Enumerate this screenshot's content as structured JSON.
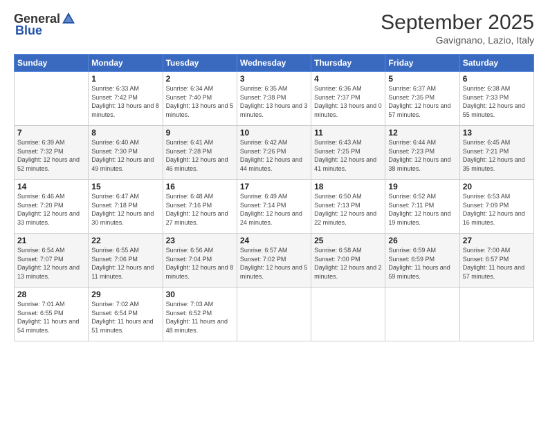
{
  "header": {
    "logo_general": "General",
    "logo_blue": "Blue",
    "month_title": "September 2025",
    "subtitle": "Gavignano, Lazio, Italy"
  },
  "days_of_week": [
    "Sunday",
    "Monday",
    "Tuesday",
    "Wednesday",
    "Thursday",
    "Friday",
    "Saturday"
  ],
  "weeks": [
    [
      {
        "day": "",
        "sunrise": "",
        "sunset": "",
        "daylight": ""
      },
      {
        "day": "1",
        "sunrise": "Sunrise: 6:33 AM",
        "sunset": "Sunset: 7:42 PM",
        "daylight": "Daylight: 13 hours and 8 minutes."
      },
      {
        "day": "2",
        "sunrise": "Sunrise: 6:34 AM",
        "sunset": "Sunset: 7:40 PM",
        "daylight": "Daylight: 13 hours and 5 minutes."
      },
      {
        "day": "3",
        "sunrise": "Sunrise: 6:35 AM",
        "sunset": "Sunset: 7:38 PM",
        "daylight": "Daylight: 13 hours and 3 minutes."
      },
      {
        "day": "4",
        "sunrise": "Sunrise: 6:36 AM",
        "sunset": "Sunset: 7:37 PM",
        "daylight": "Daylight: 13 hours and 0 minutes."
      },
      {
        "day": "5",
        "sunrise": "Sunrise: 6:37 AM",
        "sunset": "Sunset: 7:35 PM",
        "daylight": "Daylight: 12 hours and 57 minutes."
      },
      {
        "day": "6",
        "sunrise": "Sunrise: 6:38 AM",
        "sunset": "Sunset: 7:33 PM",
        "daylight": "Daylight: 12 hours and 55 minutes."
      }
    ],
    [
      {
        "day": "7",
        "sunrise": "Sunrise: 6:39 AM",
        "sunset": "Sunset: 7:32 PM",
        "daylight": "Daylight: 12 hours and 52 minutes."
      },
      {
        "day": "8",
        "sunrise": "Sunrise: 6:40 AM",
        "sunset": "Sunset: 7:30 PM",
        "daylight": "Daylight: 12 hours and 49 minutes."
      },
      {
        "day": "9",
        "sunrise": "Sunrise: 6:41 AM",
        "sunset": "Sunset: 7:28 PM",
        "daylight": "Daylight: 12 hours and 46 minutes."
      },
      {
        "day": "10",
        "sunrise": "Sunrise: 6:42 AM",
        "sunset": "Sunset: 7:26 PM",
        "daylight": "Daylight: 12 hours and 44 minutes."
      },
      {
        "day": "11",
        "sunrise": "Sunrise: 6:43 AM",
        "sunset": "Sunset: 7:25 PM",
        "daylight": "Daylight: 12 hours and 41 minutes."
      },
      {
        "day": "12",
        "sunrise": "Sunrise: 6:44 AM",
        "sunset": "Sunset: 7:23 PM",
        "daylight": "Daylight: 12 hours and 38 minutes."
      },
      {
        "day": "13",
        "sunrise": "Sunrise: 6:45 AM",
        "sunset": "Sunset: 7:21 PM",
        "daylight": "Daylight: 12 hours and 35 minutes."
      }
    ],
    [
      {
        "day": "14",
        "sunrise": "Sunrise: 6:46 AM",
        "sunset": "Sunset: 7:20 PM",
        "daylight": "Daylight: 12 hours and 33 minutes."
      },
      {
        "day": "15",
        "sunrise": "Sunrise: 6:47 AM",
        "sunset": "Sunset: 7:18 PM",
        "daylight": "Daylight: 12 hours and 30 minutes."
      },
      {
        "day": "16",
        "sunrise": "Sunrise: 6:48 AM",
        "sunset": "Sunset: 7:16 PM",
        "daylight": "Daylight: 12 hours and 27 minutes."
      },
      {
        "day": "17",
        "sunrise": "Sunrise: 6:49 AM",
        "sunset": "Sunset: 7:14 PM",
        "daylight": "Daylight: 12 hours and 24 minutes."
      },
      {
        "day": "18",
        "sunrise": "Sunrise: 6:50 AM",
        "sunset": "Sunset: 7:13 PM",
        "daylight": "Daylight: 12 hours and 22 minutes."
      },
      {
        "day": "19",
        "sunrise": "Sunrise: 6:52 AM",
        "sunset": "Sunset: 7:11 PM",
        "daylight": "Daylight: 12 hours and 19 minutes."
      },
      {
        "day": "20",
        "sunrise": "Sunrise: 6:53 AM",
        "sunset": "Sunset: 7:09 PM",
        "daylight": "Daylight: 12 hours and 16 minutes."
      }
    ],
    [
      {
        "day": "21",
        "sunrise": "Sunrise: 6:54 AM",
        "sunset": "Sunset: 7:07 PM",
        "daylight": "Daylight: 12 hours and 13 minutes."
      },
      {
        "day": "22",
        "sunrise": "Sunrise: 6:55 AM",
        "sunset": "Sunset: 7:06 PM",
        "daylight": "Daylight: 12 hours and 11 minutes."
      },
      {
        "day": "23",
        "sunrise": "Sunrise: 6:56 AM",
        "sunset": "Sunset: 7:04 PM",
        "daylight": "Daylight: 12 hours and 8 minutes."
      },
      {
        "day": "24",
        "sunrise": "Sunrise: 6:57 AM",
        "sunset": "Sunset: 7:02 PM",
        "daylight": "Daylight: 12 hours and 5 minutes."
      },
      {
        "day": "25",
        "sunrise": "Sunrise: 6:58 AM",
        "sunset": "Sunset: 7:00 PM",
        "daylight": "Daylight: 12 hours and 2 minutes."
      },
      {
        "day": "26",
        "sunrise": "Sunrise: 6:59 AM",
        "sunset": "Sunset: 6:59 PM",
        "daylight": "Daylight: 11 hours and 59 minutes."
      },
      {
        "day": "27",
        "sunrise": "Sunrise: 7:00 AM",
        "sunset": "Sunset: 6:57 PM",
        "daylight": "Daylight: 11 hours and 57 minutes."
      }
    ],
    [
      {
        "day": "28",
        "sunrise": "Sunrise: 7:01 AM",
        "sunset": "Sunset: 6:55 PM",
        "daylight": "Daylight: 11 hours and 54 minutes."
      },
      {
        "day": "29",
        "sunrise": "Sunrise: 7:02 AM",
        "sunset": "Sunset: 6:54 PM",
        "daylight": "Daylight: 11 hours and 51 minutes."
      },
      {
        "day": "30",
        "sunrise": "Sunrise: 7:03 AM",
        "sunset": "Sunset: 6:52 PM",
        "daylight": "Daylight: 11 hours and 48 minutes."
      },
      {
        "day": "",
        "sunrise": "",
        "sunset": "",
        "daylight": ""
      },
      {
        "day": "",
        "sunrise": "",
        "sunset": "",
        "daylight": ""
      },
      {
        "day": "",
        "sunrise": "",
        "sunset": "",
        "daylight": ""
      },
      {
        "day": "",
        "sunrise": "",
        "sunset": "",
        "daylight": ""
      }
    ]
  ]
}
